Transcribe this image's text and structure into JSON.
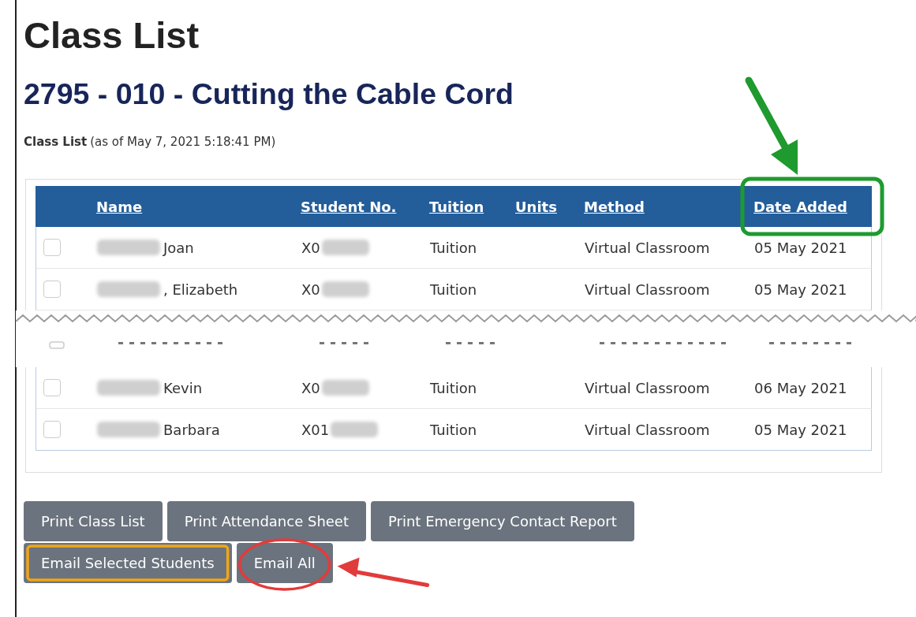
{
  "page": {
    "title": "Class List",
    "course": "2795 - 010 - Cutting the Cable Cord",
    "caption": {
      "label": "Class List",
      "timestamp": "(as of May 7, 2021 5:18:41 PM)"
    }
  },
  "table": {
    "columns": [
      "Name",
      "Student No.",
      "Tuition",
      "Units",
      "Method",
      "Date Added"
    ],
    "rows": [
      {
        "checked": false,
        "redacted": true,
        "name": "Joan",
        "student_no": "X0",
        "tuition": "Tuition",
        "method": "Virtual Classroom",
        "date_added": "05 May 2021"
      },
      {
        "checked": false,
        "redacted": true,
        "name": ", Elizabeth",
        "student_no": "X0",
        "tuition": "Tuition",
        "method": "Virtual Classroom",
        "date_added": "05 May 2021"
      }
    ],
    "rows_after_gap": [
      {
        "checked": false,
        "redacted": true,
        "name": "Kevin",
        "student_no": "X0",
        "tuition": "Tuition",
        "method": "Virtual Classroom",
        "date_added": "06 May 2021"
      },
      {
        "checked": false,
        "redacted": true,
        "name": "Barbara",
        "student_no": "X01",
        "tuition": "Tuition",
        "method": "Virtual Classroom",
        "date_added": "05 May 2021"
      }
    ]
  },
  "buttons": [
    [
      {
        "label": "Print Class List"
      },
      {
        "label": "Print Attendance Sheet"
      },
      {
        "label": "Print Emergency Contact Report"
      }
    ],
    [
      {
        "label": "Email Selected Students"
      },
      {
        "label": "Email All"
      }
    ]
  ],
  "annotations": [
    {
      "kind": "box-arrow",
      "color": "#1f9a2e"
    },
    {
      "kind": "box",
      "color": "#f2a516"
    },
    {
      "kind": "ring-arrow",
      "color": "#e23b3b"
    }
  ]
}
